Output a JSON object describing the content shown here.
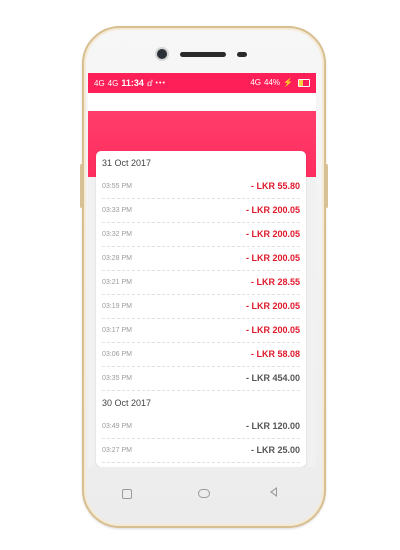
{
  "status_bar": {
    "network_1": "4G",
    "network_2": "4G",
    "time": "11:34",
    "notification": "ⅆ",
    "dots": "•••",
    "network_right": "4G",
    "battery": "44%",
    "charging": "⚡"
  },
  "transactions": {
    "group1": {
      "date": "31 Oct 2017",
      "items": [
        {
          "time": "03:55 PM",
          "amount": "- LKR 55.80"
        },
        {
          "time": "03:33 PM",
          "amount": "- LKR 200.05"
        },
        {
          "time": "03:32 PM",
          "amount": "- LKR 200.05"
        },
        {
          "time": "03:28 PM",
          "amount": "- LKR 200.05"
        },
        {
          "time": "03:21 PM",
          "amount": "- LKR 28.55"
        },
        {
          "time": "03:19 PM",
          "amount": "- LKR 200.05"
        },
        {
          "time": "03:17 PM",
          "amount": "- LKR 200.05"
        },
        {
          "time": "03:06 PM",
          "amount": "- LKR 58.08"
        },
        {
          "time": "03:35 PM",
          "amount": "- LKR 454.00"
        }
      ]
    },
    "group2": {
      "date": "30 Oct 2017",
      "items": [
        {
          "time": "03:49 PM",
          "amount": "- LKR 120.00"
        },
        {
          "time": "03:27 PM",
          "amount": "- LKR 25.00"
        }
      ]
    }
  },
  "colors": {
    "accent": "#ff1f58",
    "negative": "#e0192a",
    "neutral": "#555555"
  }
}
